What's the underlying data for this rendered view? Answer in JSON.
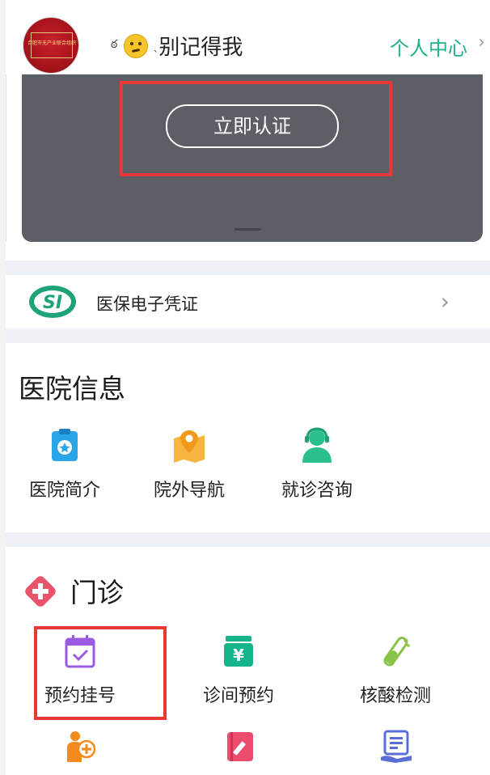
{
  "header": {
    "avatar_seal_text": "合肥市无产业联合组织",
    "user_name": "别记得我",
    "personal_center": "个人中心"
  },
  "card": {
    "verify_button": "立即认证"
  },
  "insurance": {
    "label": "医保电子凭证",
    "logo_text": "SI"
  },
  "hospital_info": {
    "title": "医院信息",
    "items": [
      {
        "label": "医院简介",
        "icon": "clipboard-badge-icon"
      },
      {
        "label": "院外导航",
        "icon": "map-pin-icon"
      },
      {
        "label": "就诊咨询",
        "icon": "support-agent-icon"
      }
    ]
  },
  "outpatient": {
    "title": "门诊",
    "items": [
      {
        "label": "预约挂号",
        "icon": "calendar-check-icon"
      },
      {
        "label": "诊间预约",
        "icon": "yen-box-icon"
      },
      {
        "label": "核酸检测",
        "icon": "test-tube-icon"
      }
    ],
    "icons_row2": [
      "person-plus-icon",
      "notebook-pen-icon",
      "list-hand-icon"
    ]
  },
  "colors": {
    "accent_green": "#1fb28a",
    "card_dark": "#5c5f66",
    "highlight_red": "#e53935",
    "section_gap": "#eef2f6"
  }
}
